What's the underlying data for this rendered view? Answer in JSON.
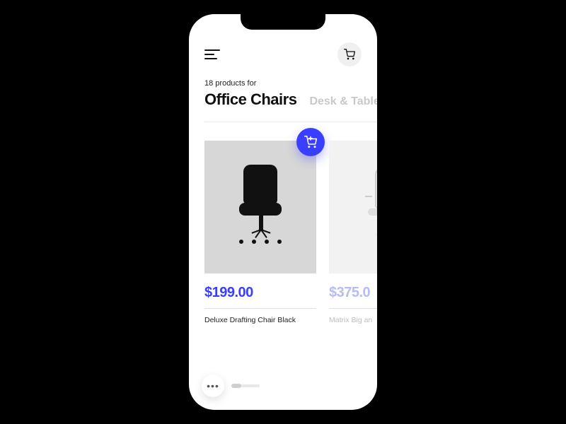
{
  "header": {
    "product_count_label": "18 products for"
  },
  "tabs": {
    "active": "Office Chairs",
    "inactive": "Desk & Table"
  },
  "products": [
    {
      "price": "$199.00",
      "name": "Deluxe Drafting Chair Black"
    },
    {
      "price": "$375.0",
      "name": "Matrix Big an"
    }
  ],
  "colors": {
    "accent": "#3a3fff",
    "accentFaded": "#b9bbf5"
  },
  "more_label": "•••"
}
